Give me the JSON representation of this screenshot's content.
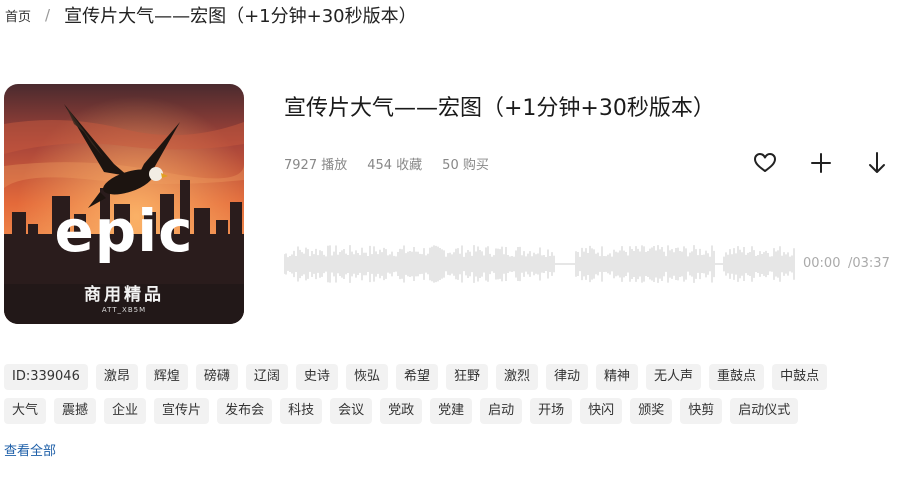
{
  "breadcrumb": {
    "home_label": "首页",
    "separator": "/",
    "current": "宣传片大气——宏图（+1分钟+30秒版本）"
  },
  "cover": {
    "title_text": "epic",
    "subtitle_text": "商用精品",
    "tiny_text": "ATT_XB5M"
  },
  "track": {
    "title": "宣传片大气——宏图（+1分钟+30秒版本）",
    "plays": "7927 播放",
    "favorites": "454 收藏",
    "purchases": "50 购买"
  },
  "actions": {
    "favorite_icon": "heart-icon",
    "add_icon": "plus-icon",
    "download_icon": "download-arrow-icon"
  },
  "player": {
    "current_time": "00:00",
    "total_time": "/03:37",
    "progress": 0
  },
  "tags": {
    "id_label": "ID:339046",
    "items": [
      "激昂",
      "辉煌",
      "磅礴",
      "辽阔",
      "史诗",
      "恢弘",
      "希望",
      "狂野",
      "激烈",
      "律动",
      "精神",
      "无人声",
      "重鼓点",
      "中鼓点",
      "大气",
      "震撼",
      "企业",
      "宣传片",
      "发布会",
      "科技",
      "会议",
      "党政",
      "党建",
      "启动",
      "开场",
      "快闪",
      "颁奖",
      "快剪",
      "启动仪式"
    ]
  },
  "view_all_label": "查看全部",
  "colors": {
    "link": "#1e5fa8",
    "tag_bg": "#f2f2f2",
    "waveform": "#cccccc",
    "text_muted": "#888888"
  }
}
